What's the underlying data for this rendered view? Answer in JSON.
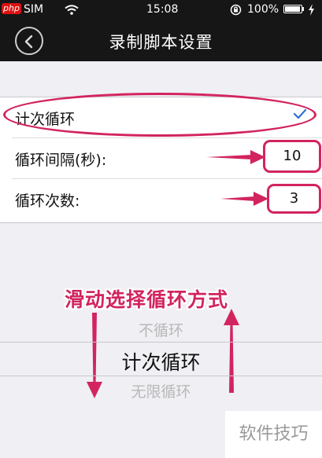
{
  "status_bar": {
    "app_badge": "php",
    "carrier": "SIM",
    "time": "15:08",
    "battery_percent": "100%",
    "battery_level": 1.0,
    "icons": [
      "wifi-icon",
      "rotation-lock-icon",
      "battery-icon",
      "charging-icon"
    ]
  },
  "nav": {
    "title": "录制脚本设置",
    "back_icon": "chevron-left-icon"
  },
  "settings": {
    "loop_mode_label": "计次循环",
    "loop_mode_checked": true,
    "interval_label": "循环间隔(秒):",
    "interval_value": "10",
    "count_label": "循环次数:",
    "count_value": "3"
  },
  "annotation": {
    "text": "滑动选择循环方式",
    "color": "#d2245e"
  },
  "picker": {
    "options": [
      "不循环",
      "计次循环",
      "无限循环"
    ],
    "selected": "计次循环"
  },
  "watermark": {
    "text": "软件技巧"
  },
  "colors": {
    "accent": "#d2245e",
    "check": "#2f6fd6",
    "bar": "#161616",
    "background": "#efeff4"
  }
}
